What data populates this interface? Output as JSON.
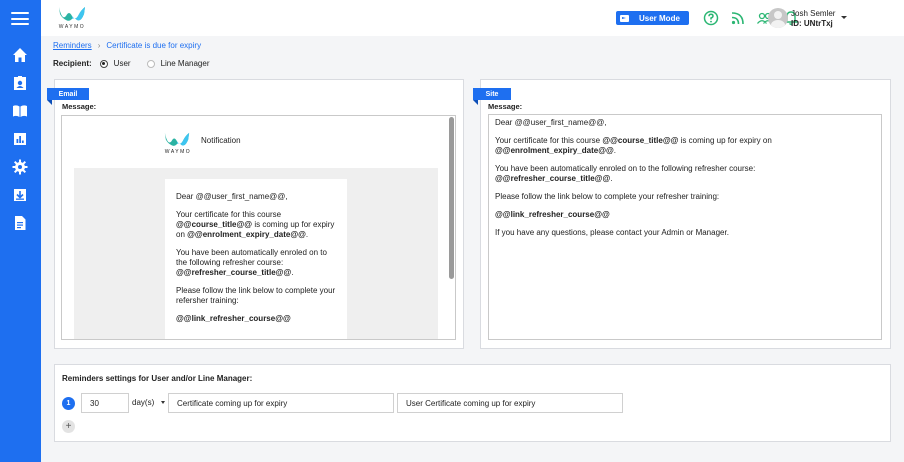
{
  "brand": {
    "logo_text": "WAYMO",
    "accent": "#1e6ff0"
  },
  "sidebar": {
    "icons": [
      "menu-icon",
      "home-icon",
      "badge-icon",
      "library-icon",
      "chart-icon",
      "gear-icon",
      "download-icon",
      "document-icon"
    ]
  },
  "topbar": {
    "user_mode_label": "User Mode",
    "user_name": "Josh Semler",
    "user_id": "ID: UNtrTxj"
  },
  "breadcrumb": {
    "parent": "Reminders",
    "current": "Certificate is due for expiry"
  },
  "recipient": {
    "label": "Recipient:",
    "options": [
      "User",
      "Line Manager"
    ],
    "selected": "User"
  },
  "email": {
    "tag": "Email",
    "message_label": "Message:",
    "notification_title": "Notification",
    "greeting": "Dear @@user_first_name@@,",
    "p1_a": "Your certificate for this course ",
    "p1_b": "@@course_title@@",
    "p1_c": " is coming up for expiry on ",
    "p1_d": "@@enrolment_expiry_date@@",
    "p1_e": ".",
    "p2_a": "You have been automatically enroled on to the following refresher course: ",
    "p2_b": "@@refresher_course_title@@",
    "p2_c": ".",
    "p3": "Please follow the link below to complete your refersher training:",
    "p4": "@@link_refresher_course@@"
  },
  "site": {
    "tag": "Site",
    "message_label": "Message:",
    "greeting": "Dear @@user_first_name@@,",
    "p1_a": "Your certificate for this course ",
    "p1_b": "@@course_title@@",
    "p1_c": " is coming up for expiry on ",
    "p1_d": "@@enrolment_expiry_date@@",
    "p1_e": ".",
    "p2_a": "You have been automatically enroled on to the following refresher course: ",
    "p2_b": "@@refresher_course_title@@",
    "p2_c": ".",
    "p3": "Please follow the link below to complete your refresher training:",
    "p4": "@@link_refresher_course@@",
    "p5": "If you have any questions, please contact your Admin or Manager."
  },
  "settings": {
    "title": "Reminders settings for User and/or Line Manager:",
    "row_number": "1",
    "days_value": "30",
    "days_unit": "day(s)",
    "subject_1": "Certificate coming up for expiry",
    "subject_2": "User Certificate coming up for expiry",
    "add_label": "+"
  }
}
